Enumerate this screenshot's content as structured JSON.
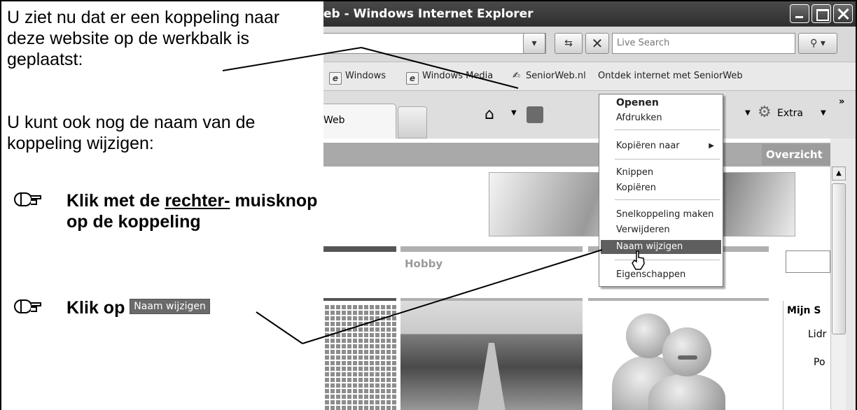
{
  "instructions": {
    "para1": "U ziet nu dat er een koppeling naar deze website op de werkbalk is geplaatst:",
    "para2": "U kunt ook nog de naam van de koppeling wijzigen:",
    "step1_prefix": "Klik met de ",
    "step1_underlined": "rechter-",
    "step1_suffix": " muisknop op de koppeling",
    "step2_prefix": "Klik op ",
    "step2_button": "Naam wijzigen"
  },
  "browser": {
    "title": "eb - Windows Internet Explorer",
    "search_placeholder": "Live Search",
    "links": [
      "Windows",
      "Windows Media",
      "SeniorWeb.nl",
      "Ontdek internet met SeniorWeb"
    ],
    "tab_label": "Web",
    "extra_label": "Extra",
    "page": {
      "overzicht": "Overzicht",
      "hobby": "Hobby",
      "mijn": "Mijn S",
      "lidr": "Lidr",
      "po": "Po"
    }
  },
  "context_menu": {
    "items": [
      "Openen",
      "Afdrukken",
      "Kopiëren naar",
      "Knippen",
      "Kopiëren",
      "Snelkoppeling maken",
      "Verwijderen",
      "Naam wijzigen",
      "Eigenschappen"
    ],
    "highlighted": "Naam wijzigen"
  },
  "icons": {
    "hand": "pointing-hand-icon",
    "home": "home-icon",
    "feed": "feed-icon",
    "gear": "gear-icon",
    "cursor": "mouse-cursor-icon"
  },
  "colors": {
    "highlight": "#5f5f5f",
    "titlebar": "#3a3a3a"
  }
}
